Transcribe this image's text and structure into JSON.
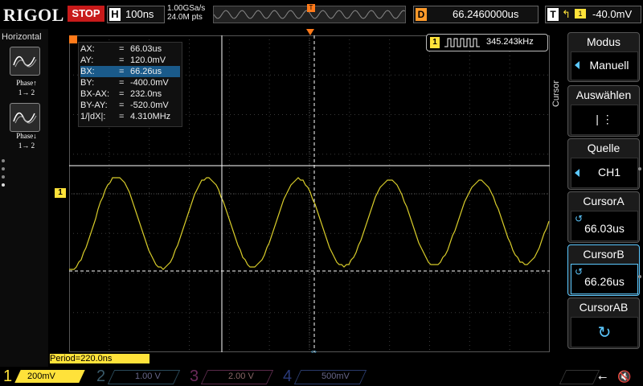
{
  "top": {
    "logo": "RIGOL",
    "run_state": "STOP",
    "horizontal_label": "H",
    "timebase": "100ns",
    "sample_rate": "1.00GSa/s",
    "points": "24.0M pts",
    "trigger_marker": "T",
    "delay_label": "D",
    "delay_value": "66.2460000us",
    "trigger_label": "T",
    "trigger_level": "-40.0mV"
  },
  "left": {
    "title": "Horizontal",
    "phase1": "Phase↑",
    "phase1_sub": "1→ 2",
    "phase2": "Phase↓",
    "phase2_sub": "1→ 2"
  },
  "cursor_readout": {
    "rows": [
      {
        "key": "AX:",
        "val": "66.03us"
      },
      {
        "key": "AY:",
        "val": "120.0mV"
      },
      {
        "key": "BX:",
        "val": "66.26us"
      },
      {
        "key": "BY:",
        "val": "-400.0mV"
      },
      {
        "key": "BX-AX:",
        "val": "232.0ns"
      },
      {
        "key": "BY-AY:",
        "val": "-520.0mV"
      },
      {
        "key": "1/|dX|:",
        "val": "4.310MHz"
      }
    ]
  },
  "frequency": {
    "channel": "1",
    "value": "345.243kHz"
  },
  "period": "Period=220.0ns",
  "channel_marker": "1",
  "right_menu": {
    "tab": "Cursor",
    "items": [
      {
        "header": "Modus",
        "value": "Manuell"
      },
      {
        "header": "Auswählen",
        "value": "|   ⋮"
      },
      {
        "header": "Quelle",
        "value": "CH1"
      },
      {
        "header": "CursorA",
        "value": "66.03us"
      },
      {
        "header": "CursorB",
        "value": "66.26us"
      },
      {
        "header": "CursorAB",
        "value": ""
      }
    ]
  },
  "channels": [
    {
      "num": "1",
      "scale": "200mV",
      "color": "#ffe23a"
    },
    {
      "num": "2",
      "scale": "1.00 V",
      "color": "#3ac8ff"
    },
    {
      "num": "3",
      "scale": "2.00 V",
      "color": "#ff3ad0"
    },
    {
      "num": "4",
      "scale": "500mV",
      "color": "#3a6bff"
    }
  ],
  "colors": {
    "ch1": "#ffe23a",
    "accent": "#5cc8ff",
    "trigger": "#ff7a1a",
    "stop": "#c81a1a"
  },
  "icons": [
    "usb-icon",
    "speaker-mute-icon",
    "phase-rising-icon",
    "phase-falling-icon"
  ]
}
